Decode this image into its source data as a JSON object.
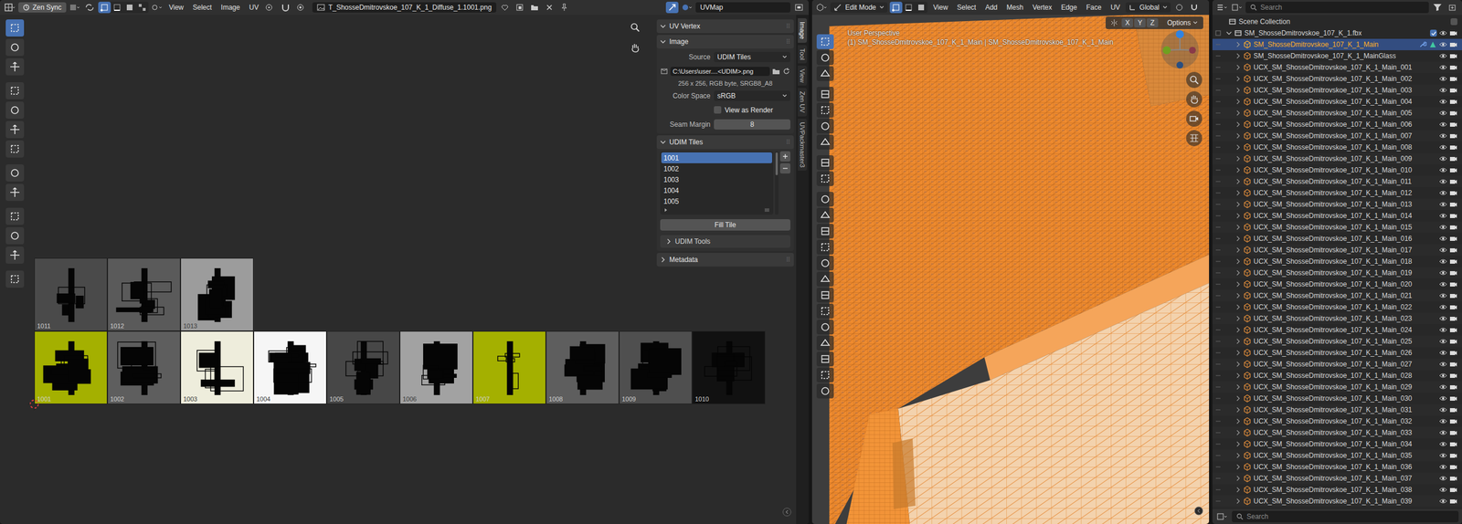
{
  "uv_editor": {
    "header": {
      "sync_label": "Zen Sync",
      "menus": [
        "View",
        "Select",
        "Image",
        "UV"
      ],
      "image_name": "T_ShosseDmitrovskoe_107_K_1_Diffuse_1.1001.png",
      "uv_map": "UVMap"
    },
    "tiles": [
      {
        "label": "1001",
        "color": "#a4b000"
      },
      {
        "label": "1002",
        "color": "#5e5e5e"
      },
      {
        "label": "1003",
        "color": "#eeeddc"
      },
      {
        "label": "1004",
        "color": "#f6f6f6"
      },
      {
        "label": "1005",
        "color": "#474747"
      },
      {
        "label": "1006",
        "color": "#a2a2a2"
      },
      {
        "label": "1007",
        "color": "#a4b000"
      },
      {
        "label": "1008",
        "color": "#5e5e5e"
      },
      {
        "label": "1009",
        "color": "#4f4f4f"
      },
      {
        "label": "1010",
        "color": "#111111"
      },
      {
        "label": "1011",
        "color": "#4a4a4a"
      },
      {
        "label": "1012",
        "color": "#5a5a5a"
      },
      {
        "label": "1013",
        "color": "#9c9c9c"
      }
    ],
    "side_tabs": [
      {
        "label": "Image",
        "selected": true
      },
      {
        "label": "Tool",
        "selected": false
      },
      {
        "label": "View",
        "selected": false
      },
      {
        "label": "Zen UV",
        "selected": false
      },
      {
        "label": "UVPackmaster3",
        "selected": false
      }
    ],
    "sidebar": {
      "uv_vertex": {
        "title": "UV Vertex",
        "expanded": true
      },
      "image": {
        "title": "Image",
        "expanded": true,
        "source_label": "Source",
        "source_value": "UDIM Tiles",
        "path": "C:\\Users\\user....<UDIM>.png",
        "info": "256 x 256,  RGB byte, SRGB8_A8",
        "color_space_label": "Color Space",
        "color_space_value": "sRGB",
        "view_as_render": {
          "label": "View as Render",
          "checked": false
        },
        "seam_margin_label": "Seam Margin",
        "seam_margin_value": "8"
      },
      "udim_tiles": {
        "title": "UDIM Tiles",
        "expanded": true,
        "items": [
          {
            "label": "1001",
            "selected": true
          },
          {
            "label": "1002",
            "selected": false
          },
          {
            "label": "1003",
            "selected": false
          },
          {
            "label": "1004",
            "selected": false
          },
          {
            "label": "1005",
            "selected": false
          }
        ],
        "fill_button": "Fill Tile",
        "tools": {
          "title": "UDIM Tools",
          "expanded": false
        }
      },
      "metadata": {
        "title": "Metadata",
        "expanded": false
      }
    }
  },
  "viewport": {
    "mode": "Edit Mode",
    "menus": [
      "View",
      "Select",
      "Add",
      "Mesh",
      "Vertex",
      "Edge",
      "Face",
      "UV"
    ],
    "orientation": "Global",
    "axes": [
      "X",
      "Y",
      "Z"
    ],
    "options": "Options",
    "view_name": "User Perspective",
    "object_info": "(1) SM_ShosseDmitrovskoe_107_K_1_Main | SM_ShosseDmitrovskoe_107_K_1_Main"
  },
  "outliner": {
    "search_placeholder": "Search",
    "root": "Scene Collection",
    "collection": {
      "name": "SM_ShosseDmitrovskoe_107_K_1.fbx",
      "expanded": true
    },
    "objects": [
      {
        "name": "SM_ShosseDmitrovskoe_107_K_1_Main",
        "selected": true
      },
      {
        "name": "SM_ShosseDmitrovskoe_107_K_1_MainGlass",
        "selected": false
      },
      {
        "name": "UCX_SM_ShosseDmitrovskoe_107_K_1_Main_001",
        "selected": false
      },
      {
        "name": "UCX_SM_ShosseDmitrovskoe_107_K_1_Main_002",
        "selected": false
      },
      {
        "name": "UCX_SM_ShosseDmitrovskoe_107_K_1_Main_003",
        "selected": false
      },
      {
        "name": "UCX_SM_ShosseDmitrovskoe_107_K_1_Main_004",
        "selected": false
      },
      {
        "name": "UCX_SM_ShosseDmitrovskoe_107_K_1_Main_005",
        "selected": false
      },
      {
        "name": "UCX_SM_ShosseDmitrovskoe_107_K_1_Main_006",
        "selected": false
      },
      {
        "name": "UCX_SM_ShosseDmitrovskoe_107_K_1_Main_007",
        "selected": false
      },
      {
        "name": "UCX_SM_ShosseDmitrovskoe_107_K_1_Main_008",
        "selected": false
      },
      {
        "name": "UCX_SM_ShosseDmitrovskoe_107_K_1_Main_009",
        "selected": false
      },
      {
        "name": "UCX_SM_ShosseDmitrovskoe_107_K_1_Main_010",
        "selected": false
      },
      {
        "name": "UCX_SM_ShosseDmitrovskoe_107_K_1_Main_011",
        "selected": false
      },
      {
        "name": "UCX_SM_ShosseDmitrovskoe_107_K_1_Main_012",
        "selected": false
      },
      {
        "name": "UCX_SM_ShosseDmitrovskoe_107_K_1_Main_013",
        "selected": false
      },
      {
        "name": "UCX_SM_ShosseDmitrovskoe_107_K_1_Main_014",
        "selected": false
      },
      {
        "name": "UCX_SM_ShosseDmitrovskoe_107_K_1_Main_015",
        "selected": false
      },
      {
        "name": "UCX_SM_ShosseDmitrovskoe_107_K_1_Main_016",
        "selected": false
      },
      {
        "name": "UCX_SM_ShosseDmitrovskoe_107_K_1_Main_017",
        "selected": false
      },
      {
        "name": "UCX_SM_ShosseDmitrovskoe_107_K_1_Main_018",
        "selected": false
      },
      {
        "name": "UCX_SM_ShosseDmitrovskoe_107_K_1_Main_019",
        "selected": false
      },
      {
        "name": "UCX_SM_ShosseDmitrovskoe_107_K_1_Main_020",
        "selected": false
      },
      {
        "name": "UCX_SM_ShosseDmitrovskoe_107_K_1_Main_021",
        "selected": false
      },
      {
        "name": "UCX_SM_ShosseDmitrovskoe_107_K_1_Main_022",
        "selected": false
      },
      {
        "name": "UCX_SM_ShosseDmitrovskoe_107_K_1_Main_023",
        "selected": false
      },
      {
        "name": "UCX_SM_ShosseDmitrovskoe_107_K_1_Main_024",
        "selected": false
      },
      {
        "name": "UCX_SM_ShosseDmitrovskoe_107_K_1_Main_025",
        "selected": false
      },
      {
        "name": "UCX_SM_ShosseDmitrovskoe_107_K_1_Main_026",
        "selected": false
      },
      {
        "name": "UCX_SM_ShosseDmitrovskoe_107_K_1_Main_027",
        "selected": false
      },
      {
        "name": "UCX_SM_ShosseDmitrovskoe_107_K_1_Main_028",
        "selected": false
      },
      {
        "name": "UCX_SM_ShosseDmitrovskoe_107_K_1_Main_029",
        "selected": false
      },
      {
        "name": "UCX_SM_ShosseDmitrovskoe_107_K_1_Main_030",
        "selected": false
      },
      {
        "name": "UCX_SM_ShosseDmitrovskoe_107_K_1_Main_031",
        "selected": false
      },
      {
        "name": "UCX_SM_ShosseDmitrovskoe_107_K_1_Main_032",
        "selected": false
      },
      {
        "name": "UCX_SM_ShosseDmitrovskoe_107_K_1_Main_033",
        "selected": false
      },
      {
        "name": "UCX_SM_ShosseDmitrovskoe_107_K_1_Main_034",
        "selected": false
      },
      {
        "name": "UCX_SM_ShosseDmitrovskoe_107_K_1_Main_035",
        "selected": false
      },
      {
        "name": "UCX_SM_ShosseDmitrovskoe_107_K_1_Main_036",
        "selected": false
      },
      {
        "name": "UCX_SM_ShosseDmitrovskoe_107_K_1_Main_037",
        "selected": false
      },
      {
        "name": "UCX_SM_ShosseDmitrovskoe_107_K_1_Main_038",
        "selected": false
      },
      {
        "name": "UCX_SM_ShosseDmitrovskoe_107_K_1_Main_039",
        "selected": false
      }
    ],
    "properties_search": "Search"
  }
}
